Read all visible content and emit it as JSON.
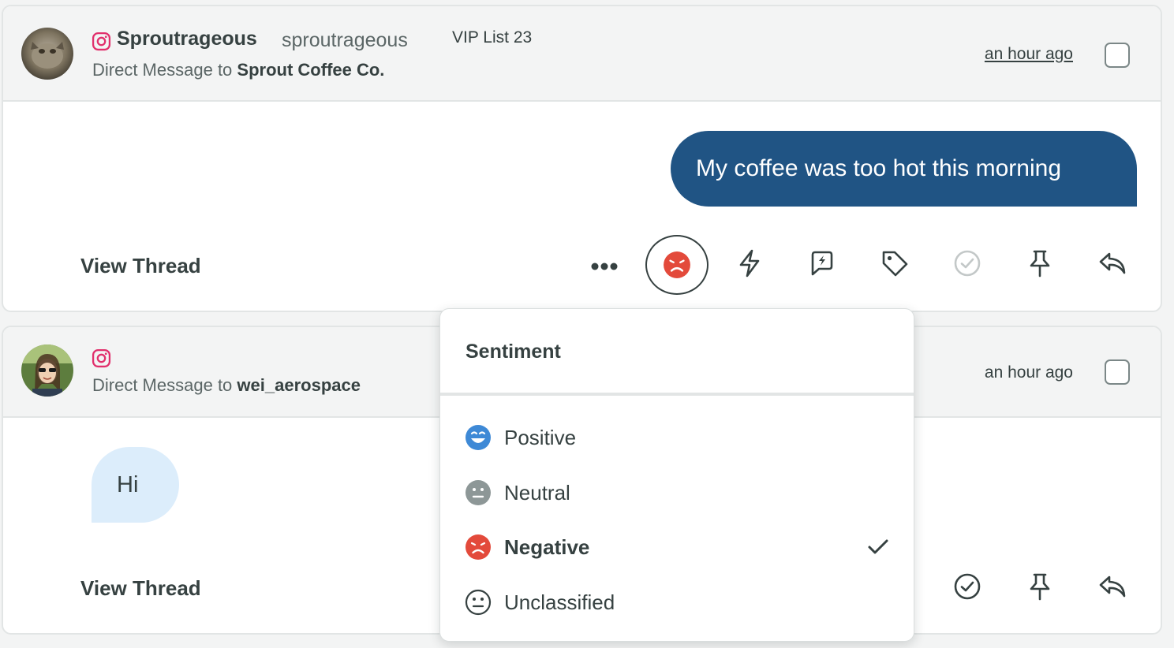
{
  "messages": [
    {
      "author_name": "Sproutrageous",
      "author_handle": "sproutrageous",
      "list_tag": "VIP List 23",
      "dm_prefix": "Direct Message to",
      "dm_recipient": "Sprout Coffee Co.",
      "timestamp": "an hour ago",
      "body": "My coffee was too hot this morning",
      "view_thread": "View Thread",
      "actions": [
        "more-icon",
        "sentiment-negative-icon",
        "bolt-icon",
        "spike-alert-icon",
        "tag-icon",
        "complete-icon",
        "pin-icon",
        "reply-icon"
      ]
    },
    {
      "dm_prefix": "Direct Message to",
      "dm_recipient": "wei_aerospace",
      "timestamp": "an hour ago",
      "body": "Hi",
      "view_thread": "View Thread",
      "actions": [
        "complete-icon",
        "pin-icon",
        "reply-icon"
      ]
    }
  ],
  "sentiment_menu": {
    "title": "Sentiment",
    "options": [
      {
        "label": "Positive",
        "icon": "positive-face-icon",
        "color": "#3e89d6"
      },
      {
        "label": "Neutral",
        "icon": "neutral-face-icon",
        "color": "#8d9797"
      },
      {
        "label": "Negative",
        "icon": "negative-face-icon",
        "color": "#e34a3b",
        "selected": true
      },
      {
        "label": "Unclassified",
        "icon": "unclassified-face-icon",
        "color": "#364141"
      }
    ]
  },
  "colors": {
    "outgoing_bubble": "#205484",
    "incoming_bubble": "#dcedfb",
    "instagram": "#e1306c",
    "negative": "#e34a3b"
  }
}
